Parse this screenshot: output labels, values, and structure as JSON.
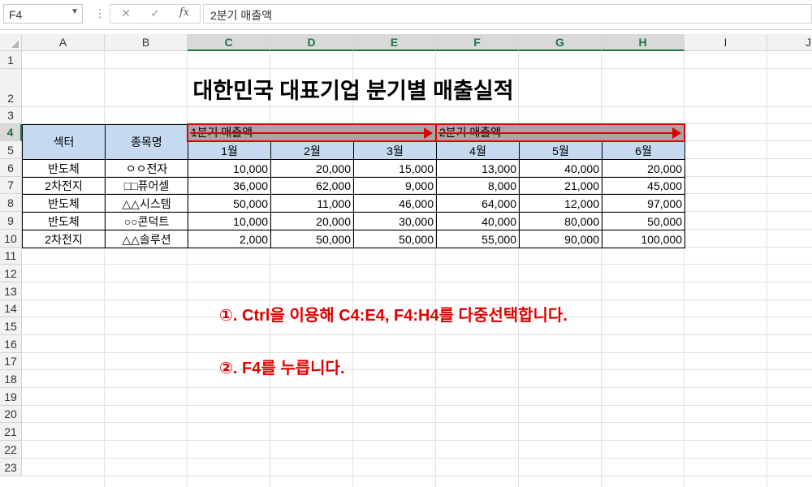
{
  "formula_bar": {
    "name_box": "F4",
    "more": "⋮",
    "cancel": "✕",
    "enter": "✓",
    "fx": "fx",
    "formula": "2분기 매출액"
  },
  "columns": [
    "A",
    "B",
    "C",
    "D",
    "E",
    "F",
    "G",
    "H",
    "I",
    "J"
  ],
  "selected_columns": [
    "C",
    "D",
    "E",
    "F",
    "G",
    "H"
  ],
  "rows": [
    "1",
    "2",
    "3",
    "4",
    "5",
    "6",
    "7",
    "8",
    "9",
    "10",
    "11",
    "12",
    "13",
    "14",
    "15",
    "16",
    "17",
    "18",
    "19",
    "20",
    "21",
    "22",
    "23"
  ],
  "selected_row": "4",
  "sheet": {
    "title": "대한민국 대표기업 분기별 매출실적",
    "header": {
      "sector": "섹터",
      "stock": "종목명",
      "q1": "1분기 매출액",
      "q2": "2분기 매출액",
      "months": [
        "1월",
        "2월",
        "3월",
        "4월",
        "5월",
        "6월"
      ]
    },
    "rows": [
      {
        "sector": "반도체",
        "stock": "ㅇㅇ전자",
        "values": [
          "10,000",
          "20,000",
          "15,000",
          "13,000",
          "40,000",
          "20,000"
        ]
      },
      {
        "sector": "2차전지",
        "stock": "□□퓨어셀",
        "values": [
          "36,000",
          "62,000",
          "9,000",
          "8,000",
          "21,000",
          "45,000"
        ]
      },
      {
        "sector": "반도체",
        "stock": "△△시스템",
        "values": [
          "50,000",
          "11,000",
          "46,000",
          "64,000",
          "12,000",
          "97,000"
        ]
      },
      {
        "sector": "반도체",
        "stock": "○○콘덕트",
        "values": [
          "10,000",
          "20,000",
          "30,000",
          "40,000",
          "80,000",
          "50,000"
        ]
      },
      {
        "sector": "2차전지",
        "stock": "△△솔루션",
        "values": [
          "2,000",
          "50,000",
          "50,000",
          "55,000",
          "90,000",
          "100,000"
        ]
      }
    ]
  },
  "annotations": {
    "step1": "①. Ctrl을 이용해 C4:E4, F4:H4를 다중선택합니다.",
    "step2": "②. F4를 누릅니다."
  },
  "colors": {
    "header_fill": "#c5d9f1",
    "selection_fill": "#a6a6a6",
    "annotation_red": "#e00000",
    "excel_green": "#217346"
  }
}
